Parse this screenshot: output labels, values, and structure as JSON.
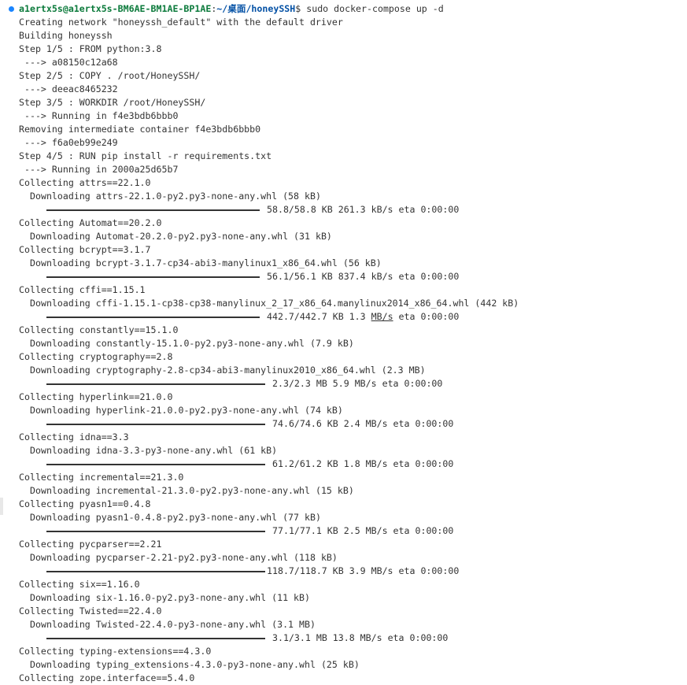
{
  "prompt": {
    "user_host": "a1ertx5s@a1ertx5s-BM6AE-BM1AE-BP1AE",
    "separator": ":",
    "path": "~/桌面/honeySSH",
    "symbol": "$",
    "command": " sudo docker-compose up -d"
  },
  "lines": [
    "Creating network \"honeyssh_default\" with the default driver",
    "Building honeyssh",
    "Step 1/5 : FROM python:3.8",
    " ---> a08150c12a68",
    "Step 2/5 : COPY . /root/HoneySSH/",
    " ---> deeac8465232",
    "Step 3/5 : WORKDIR /root/HoneySSH/",
    " ---> Running in f4e3bdb6bbb0",
    "Removing intermediate container f4e3bdb6bbb0",
    " ---> f6a0eb99e249",
    "Step 4/5 : RUN pip install -r requirements.txt",
    " ---> Running in 2000a25d65b7"
  ],
  "packages": [
    {
      "collecting": "Collecting attrs==22.1.0",
      "downloading": "Downloading attrs-22.1.0-py2.py3-none-any.whl (58 kB)",
      "progress": "58.8/58.8 KB 261.3 kB/s eta 0:00:00",
      "progress_fraction": 1.0
    },
    {
      "collecting": "Collecting Automat==20.2.0",
      "downloading": "Downloading Automat-20.2.0-py2.py3-none-any.whl (31 kB)"
    },
    {
      "collecting": "Collecting bcrypt==3.1.7",
      "downloading": "Downloading bcrypt-3.1.7-cp34-abi3-manylinux1_x86_64.whl (56 kB)",
      "progress": "56.1/56.1 KB 837.4 kB/s eta 0:00:00",
      "progress_fraction": 1.0
    },
    {
      "collecting": "Collecting cffi==1.15.1",
      "downloading": "Downloading cffi-1.15.1-cp38-cp38-manylinux_2_17_x86_64.manylinux2014_x86_64.whl (442 kB)",
      "progress_pre": "442.7/442.7 KB 1.3 ",
      "progress_ul": "MB/s",
      "progress_post": " eta 0:00:00",
      "progress_fraction": 1.0
    },
    {
      "collecting": "Collecting constantly==15.1.0",
      "downloading": "Downloading constantly-15.1.0-py2.py3-none-any.whl (7.9 kB)"
    },
    {
      "collecting": "Collecting cryptography==2.8",
      "downloading": "Downloading cryptography-2.8-cp34-abi3-manylinux2010_x86_64.whl (2.3 MB)",
      "progress": "2.3/2.3 MB 5.9 MB/s eta 0:00:00",
      "progress_fraction": 1.0
    },
    {
      "collecting": "Collecting hyperlink==21.0.0",
      "downloading": "Downloading hyperlink-21.0.0-py2.py3-none-any.whl (74 kB)",
      "progress": "74.6/74.6 KB 2.4 MB/s eta 0:00:00",
      "progress_fraction": 1.0
    },
    {
      "collecting": "Collecting idna==3.3",
      "downloading": "Downloading idna-3.3-py3-none-any.whl (61 kB)",
      "progress": "61.2/61.2 KB 1.8 MB/s eta 0:00:00",
      "progress_fraction": 1.0
    },
    {
      "collecting": "Collecting incremental==21.3.0",
      "downloading": "Downloading incremental-21.3.0-py2.py3-none-any.whl (15 kB)"
    },
    {
      "collecting": "Collecting pyasn1==0.4.8",
      "downloading": "Downloading pyasn1-0.4.8-py2.py3-none-any.whl (77 kB)",
      "progress": "77.1/77.1 KB 2.5 MB/s eta 0:00:00",
      "progress_fraction": 1.0
    },
    {
      "collecting": "Collecting pycparser==2.21",
      "downloading": "Downloading pycparser-2.21-py2.py3-none-any.whl (118 kB)",
      "progress": "118.7/118.7 KB 3.9 MB/s eta 0:00:00",
      "progress_fraction": 1.0
    },
    {
      "collecting": "Collecting six==1.16.0",
      "downloading": "Downloading six-1.16.0-py2.py3-none-any.whl (11 kB)"
    },
    {
      "collecting": "Collecting Twisted==22.4.0",
      "downloading": "Downloading Twisted-22.4.0-py3-none-any.whl (3.1 MB)",
      "progress": "3.1/3.1 MB 13.8 MB/s eta 0:00:00",
      "progress_fraction": 1.0
    },
    {
      "collecting": "Collecting typing-extensions==4.3.0",
      "downloading": "Downloading typing_extensions-4.3.0-py3-none-any.whl (25 kB)"
    },
    {
      "collecting": "Collecting zope.interface==5.4.0"
    }
  ],
  "colors": {
    "prompt_dot": "#1a85ff",
    "user_host": "#0b7a3b",
    "path": "#0451a5",
    "text": "#333333",
    "background": "#ffffff"
  },
  "icons": {
    "prompt_dot": "circle-status-icon"
  }
}
